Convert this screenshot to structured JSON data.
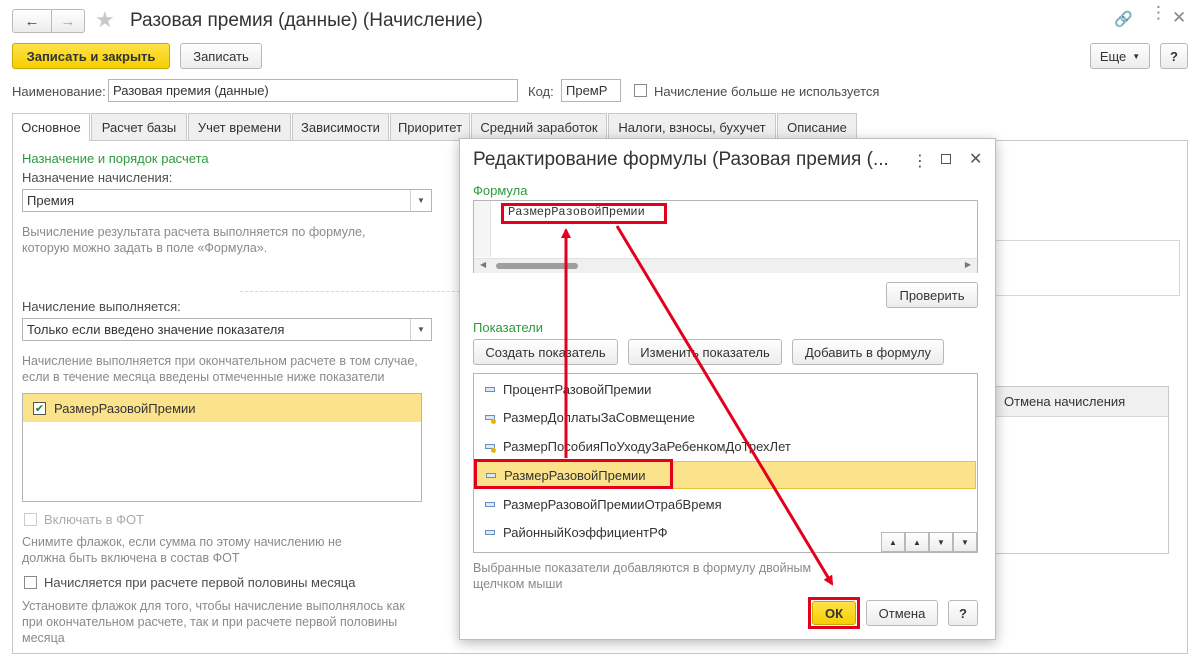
{
  "window": {
    "title": "Разовая премия (данные) (Начисление)"
  },
  "toolbar": {
    "save_close": "Записать и закрыть",
    "save": "Записать",
    "more": "Еще",
    "help": "?"
  },
  "header": {
    "name_label": "Наименование:",
    "name_value": "Разовая премия (данные)",
    "code_label": "Код:",
    "code_value": "ПремР",
    "unused_label": "Начисление больше не используется"
  },
  "tabs": [
    {
      "label": "Основное"
    },
    {
      "label": "Расчет базы"
    },
    {
      "label": "Учет времени"
    },
    {
      "label": "Зависимости"
    },
    {
      "label": "Приоритет"
    },
    {
      "label": "Средний заработок"
    },
    {
      "label": "Налоги, взносы, бухучет"
    },
    {
      "label": "Описание"
    }
  ],
  "main": {
    "section_title": "Назначение и порядок расчета",
    "purpose_label": "Назначение начисления:",
    "purpose_value": "Премия",
    "purpose_hint": "Вычисление результата расчета выполняется по формуле, которую можно задать в поле «Формула».",
    "performed_label": "Начисление выполняется:",
    "performed_value": "Только если введено значение показателя",
    "performed_hint": "Начисление выполняется при окончательном расчете в том случае, если в течение месяца введены отмеченные ниже показатели",
    "indicator_checked": "РазмерРазовойПремии",
    "fot_label": "Включать в ФОТ",
    "fot_hint": "Снимите флажок, если сумма по этому начислению не должна быть включена в состав ФОТ",
    "first_half_label": "Начисляется при расчете первой половины месяца",
    "first_half_hint": "Установите флажок для того, чтобы начисление выполнялось как при окончательном расчете, так и при расчете первой половины месяца",
    "right_column_header": "Отмена начисления"
  },
  "dialog": {
    "title": "Редактирование формулы (Разовая премия (...",
    "formula_label": "Формула",
    "formula_value": "РазмерРазовойПремии",
    "check_button": "Проверить",
    "indicators_label": "Показатели",
    "create_button": "Создать показатель",
    "edit_button": "Изменить показатель",
    "add_button": "Добавить в формулу",
    "indicators": [
      {
        "name": "ПроцентРазовойПремии"
      },
      {
        "name": "РазмерДоплатыЗаСовмещение"
      },
      {
        "name": "РазмерПособияПоУходуЗаРебенкомДоТрехЛет"
      },
      {
        "name": "РазмерРазовойПремии"
      },
      {
        "name": "РазмерРазовойПремииОтрабВремя"
      },
      {
        "name": "РайонныйКоэффициентРФ"
      }
    ],
    "hint": "Выбранные показатели добавляются в формулу двойным щелчком мыши",
    "ok_button": "ОК",
    "cancel_button": "Отмена",
    "help_button": "?"
  },
  "colors": {
    "accent_yellow": "#f5cf00",
    "annotation_red": "#e3001b",
    "section_green": "#2b9b3c",
    "selected_row": "#fbe38c"
  }
}
